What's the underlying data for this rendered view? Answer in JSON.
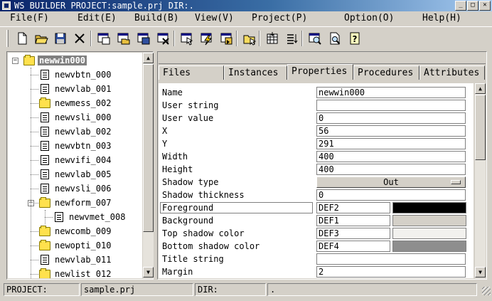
{
  "window": {
    "title": "WS BUILDER PROJECT:sample.prj DIR:."
  },
  "menu": [
    "File(F)",
    "Edit(E)",
    "Build(B)",
    "View(V)",
    "Project(P)",
    "Option(O)",
    "Help(H)"
  ],
  "toolbar": {
    "buttons": [
      {
        "name": "new-file-icon"
      },
      {
        "name": "open-folder-icon"
      },
      {
        "name": "save-icon"
      },
      {
        "name": "delete-icon"
      },
      {
        "name": "new-window-icon"
      },
      {
        "name": "open-window-icon"
      },
      {
        "name": "save-window-icon"
      },
      {
        "name": "close-window-icon"
      },
      {
        "name": "select-icon"
      },
      {
        "name": "build-icon"
      },
      {
        "name": "run-icon"
      },
      {
        "name": "folder-select-icon"
      },
      {
        "name": "grid-icon"
      },
      {
        "name": "list-icon"
      },
      {
        "name": "preview-icon"
      },
      {
        "name": "search-icon"
      },
      {
        "name": "help-icon"
      }
    ]
  },
  "tree": {
    "items": [
      {
        "label": "newwin000",
        "type": "folder",
        "depth": 0,
        "selected": true,
        "expander": "−"
      },
      {
        "label": "newvbtn_000",
        "type": "doc",
        "depth": 1
      },
      {
        "label": "newvlab_001",
        "type": "doc",
        "depth": 1
      },
      {
        "label": "newmess_002",
        "type": "folder",
        "depth": 1
      },
      {
        "label": "newvsli_000",
        "type": "doc",
        "depth": 1
      },
      {
        "label": "newvlab_002",
        "type": "doc",
        "depth": 1
      },
      {
        "label": "newvbtn_003",
        "type": "doc",
        "depth": 1
      },
      {
        "label": "newvifi_004",
        "type": "doc",
        "depth": 1
      },
      {
        "label": "newvlab_005",
        "type": "doc",
        "depth": 1
      },
      {
        "label": "newvsli_006",
        "type": "doc",
        "depth": 1
      },
      {
        "label": "newform_007",
        "type": "folder",
        "depth": 1,
        "expander": "−"
      },
      {
        "label": "newvmet_008",
        "type": "doc",
        "depth": 2
      },
      {
        "label": "newcomb_009",
        "type": "folder",
        "depth": 1
      },
      {
        "label": "newopti_010",
        "type": "folder",
        "depth": 1
      },
      {
        "label": "newvlab_011",
        "type": "doc",
        "depth": 1
      },
      {
        "label": "newlist_012",
        "type": "folder",
        "depth": 1
      }
    ]
  },
  "tabs": [
    {
      "label": "Files",
      "active": false
    },
    {
      "label": "Instances",
      "active": false
    },
    {
      "label": "Properties",
      "active": true
    },
    {
      "label": "Procedures",
      "active": false
    },
    {
      "label": "Attributes",
      "active": false
    }
  ],
  "properties": [
    {
      "label": "Name",
      "kind": "text",
      "value": "newwin000"
    },
    {
      "label": "User string",
      "kind": "text",
      "value": ""
    },
    {
      "label": "User value",
      "kind": "text",
      "value": "0"
    },
    {
      "label": "X",
      "kind": "text",
      "value": "56"
    },
    {
      "label": "Y",
      "kind": "text",
      "value": "291"
    },
    {
      "label": "Width",
      "kind": "text",
      "value": "400"
    },
    {
      "label": "Height",
      "kind": "text",
      "value": "400"
    },
    {
      "label": "Shadow type",
      "kind": "option",
      "value": "Out"
    },
    {
      "label": "Shadow thickness",
      "kind": "text",
      "value": "0"
    },
    {
      "label": "Foreground",
      "kind": "color",
      "value": "DEF2",
      "color": "#000000",
      "highlight": true
    },
    {
      "label": "Background",
      "kind": "color",
      "value": "DEF1",
      "color": "#d4d0c8"
    },
    {
      "label": "Top shadow color",
      "kind": "color",
      "value": "DEF3",
      "color": "#f2f1ee"
    },
    {
      "label": "Bottom shadow color",
      "kind": "color",
      "value": "DEF4",
      "color": "#8e8e8e"
    },
    {
      "label": "Title string",
      "kind": "text",
      "value": ""
    },
    {
      "label": "Margin",
      "kind": "text",
      "value": "2"
    }
  ],
  "status": {
    "project_label": "PROJECT:",
    "project_value": "sample.prj",
    "dir_label": "DIR:",
    "dir_value": "."
  }
}
